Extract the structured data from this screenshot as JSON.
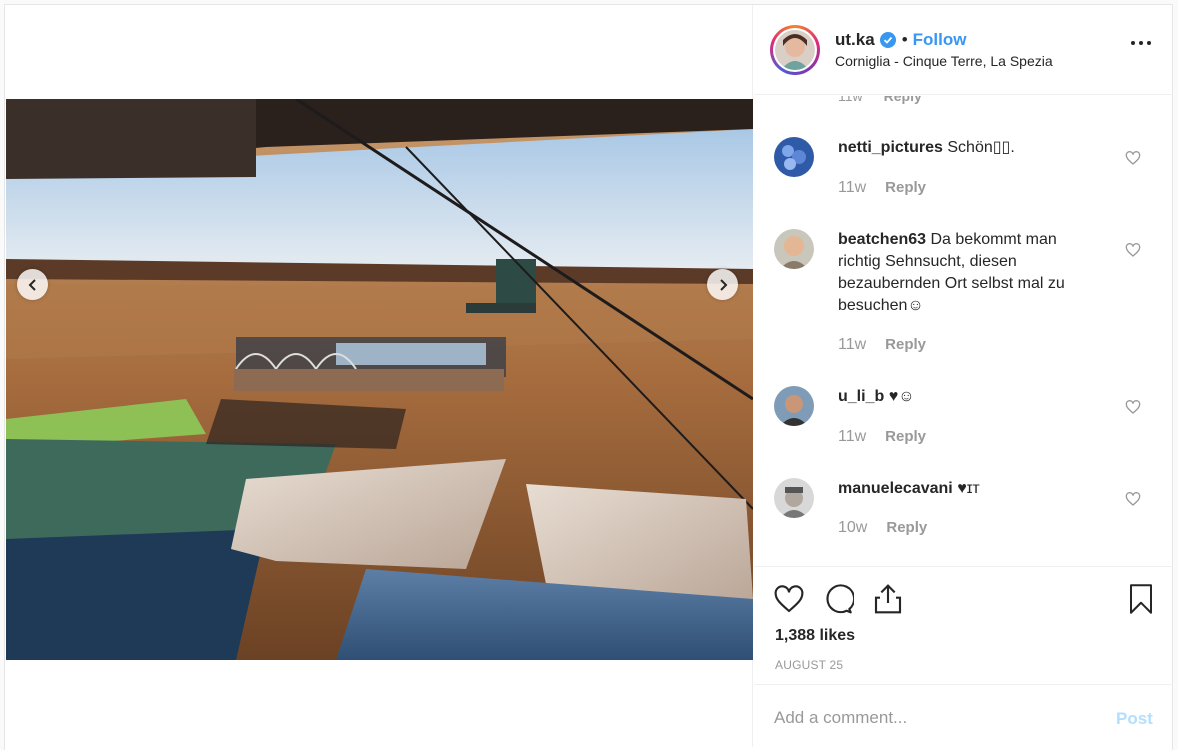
{
  "post": {
    "username": "ut.ka",
    "follow_label": "Follow",
    "separator": "•",
    "location": "Corniglia - Cinque Terre, La Spezia",
    "likes": "1,388 likes",
    "date": "AUGUST 25"
  },
  "partial_comment": {
    "age": "11w",
    "reply": "Reply"
  },
  "comments": [
    {
      "user": "netti_pictures",
      "text": "Schön▯▯.",
      "age": "11w",
      "reply": "Reply"
    },
    {
      "user": "beatchen63",
      "text": "Da bekommt man richtig Sehnsucht, diesen bezaubernden Ort selbst mal zu besuchen☺",
      "age": "11w",
      "reply": "Reply"
    },
    {
      "user": "u_li_b",
      "text": "♥☺",
      "age": "11w",
      "reply": "Reply"
    },
    {
      "user": "manuelecavani",
      "text": "♥ɪᴛ",
      "age": "10w",
      "reply": "Reply"
    }
  ],
  "add_comment": {
    "placeholder": "Add a comment...",
    "post_label": "Post"
  },
  "colors": {
    "link": "#3897f0",
    "post_disabled": "#b2dffc",
    "muted": "#999999",
    "verified": "#3897f0"
  },
  "icons": [
    "chevron-left-icon",
    "chevron-right-icon",
    "verified-badge-icon",
    "more-options-icon",
    "heart-icon",
    "comment-icon",
    "share-icon",
    "bookmark-icon"
  ]
}
